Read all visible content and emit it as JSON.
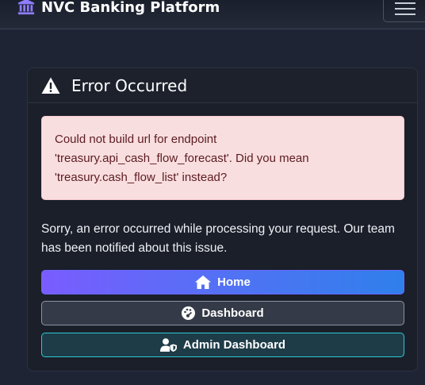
{
  "navbar": {
    "brand": "NVC Banking Platform",
    "brand_icon": "bank-icon",
    "toggler_icon": "hamburger-icon"
  },
  "card": {
    "header_icon": "warning-icon",
    "title": "Error Occurred",
    "alert_message": "Could not build url for endpoint 'treasury.api_cash_flow_forecast'. Did you mean 'treasury.cash_flow_list' instead?",
    "message": "Sorry, an error occurred while processing your request. Our team has been notified about this issue."
  },
  "buttons": {
    "home_label": "Home",
    "home_icon": "home-icon",
    "dashboard_label": "Dashboard",
    "dashboard_icon": "gauge-icon",
    "admin_label": "Admin Dashboard",
    "admin_icon": "user-shield-icon"
  },
  "colors": {
    "background": "#1e2433",
    "alert_bg": "#f9dedf",
    "home_gradient_start": "#7a5cff",
    "home_gradient_end": "#2f7fec",
    "admin_border": "#2ec8d6"
  }
}
